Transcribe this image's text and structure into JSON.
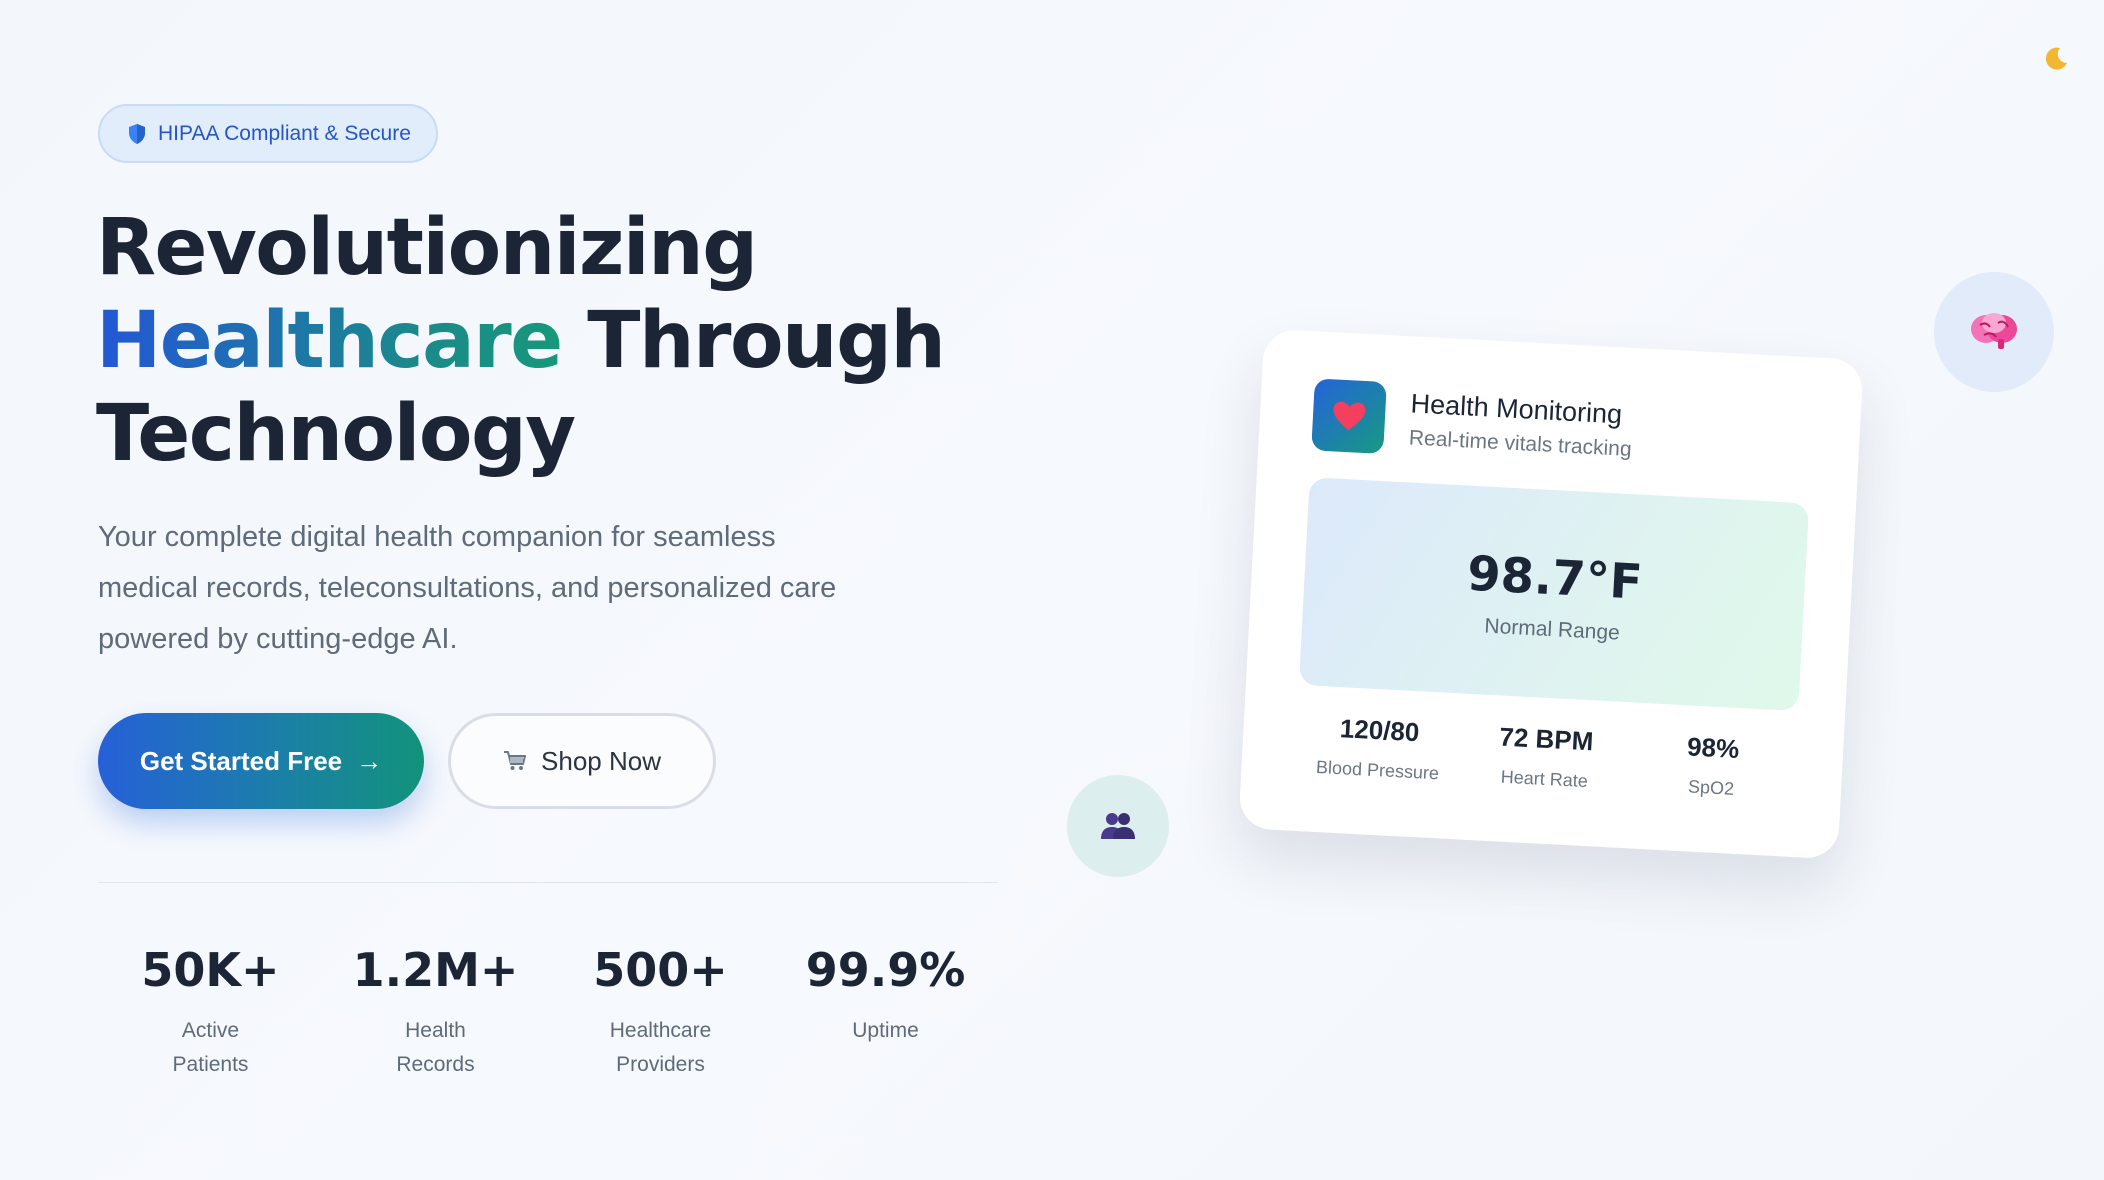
{
  "badge": {
    "icon": "shield-icon",
    "label": "HIPAA Compliant & Secure"
  },
  "hero": {
    "title_line1": "Revolutionizing",
    "title_accent": "Healthcare",
    "title_line2_rest": " Through",
    "title_line3": "Technology",
    "subtitle": "Your complete digital health companion for seamless medical records, teleconsultations, and personalized care powered by cutting-edge AI."
  },
  "buttons": {
    "primary_label": "Get Started Free",
    "primary_arrow": "→",
    "secondary_icon": "shopping-cart-icon",
    "secondary_label": "Shop Now"
  },
  "stats": [
    {
      "value": "50K+",
      "label": "Active Patients"
    },
    {
      "value": "1.2M+",
      "label": "Health Records"
    },
    {
      "value": "500+",
      "label": "Healthcare Providers"
    },
    {
      "value": "99.9%",
      "label": "Uptime"
    }
  ],
  "card": {
    "icon": "heart-icon",
    "title": "Health Monitoring",
    "subtitle": "Real-time vitals tracking",
    "temperature": "98.7°F",
    "temperature_status": "Normal Range",
    "vitals": [
      {
        "value": "120/80",
        "label": "Blood Pressure"
      },
      {
        "value": "72 BPM",
        "label": "Heart Rate"
      },
      {
        "value": "98%",
        "label": "SpO2"
      }
    ]
  },
  "decor": {
    "theme_icon": "moon-icon",
    "brain_icon": "brain-icon",
    "people_icon": "people-icon"
  },
  "colors": {
    "accent_blue": "#2660d8",
    "accent_teal": "#12937a",
    "text_dark": "#1c2536",
    "text_muted": "#5f6b7a"
  }
}
